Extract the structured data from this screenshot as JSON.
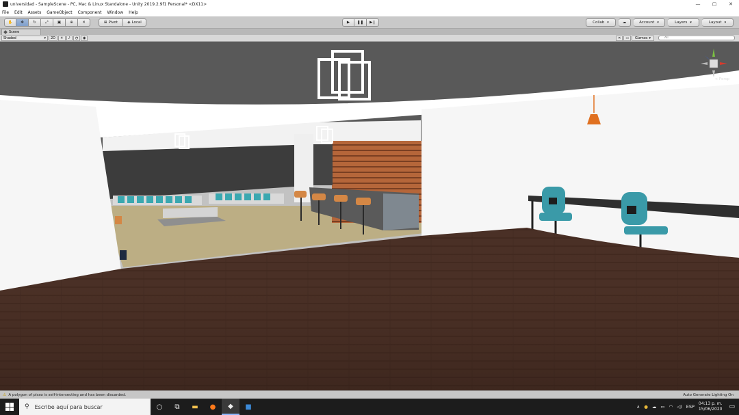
{
  "window": {
    "title": "universidad - SampleScene - PC, Mac & Linux Standalone - Unity 2019.2.9f1 Personal* <DX11>",
    "minimize": "—",
    "maximize": "▢",
    "close": "✕"
  },
  "menu": [
    "File",
    "Edit",
    "Assets",
    "GameObject",
    "Component",
    "Window",
    "Help"
  ],
  "toolbar": {
    "pivot": "Pivot",
    "local": "Local",
    "collab": "Collab",
    "account": "Account",
    "layers": "Layers",
    "layout": "Layout"
  },
  "scene": {
    "tab_label": "Scene",
    "shading_mode": "Shaded",
    "mode_2d": "2D",
    "gizmos": "Gizmos",
    "search_placeholder": "All",
    "persp_label": "< Persp"
  },
  "status": {
    "warning": "A polygon of pisso is self-intersecting and has been discarded.",
    "lighting": "Auto Generate Lighting On"
  },
  "taskbar": {
    "search_placeholder": "Escribe aquí para buscar",
    "language": "ESP",
    "time": "04:13 p. m.",
    "date": "15/06/2020"
  },
  "colors": {
    "accent_play": "#ffffff",
    "floor": "#4a3026",
    "ceiling": "#595959",
    "chair_teal": "#3a9aa8",
    "lamp_orange": "#e07020"
  }
}
